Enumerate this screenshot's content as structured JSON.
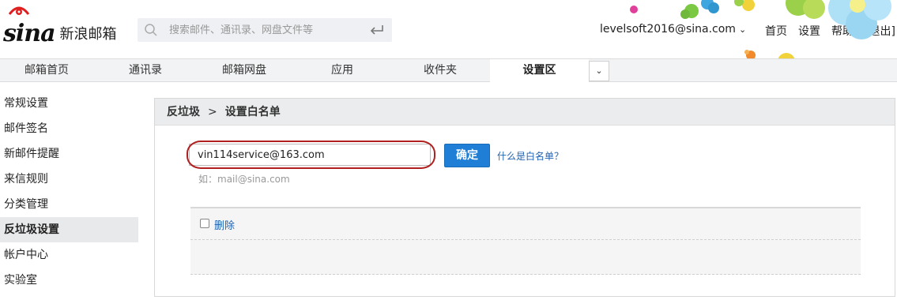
{
  "header": {
    "logo_main": "sina",
    "logo_text": "新浪邮箱",
    "search_placeholder": "搜索邮件、通讯录、网盘文件等",
    "account": "levelsoft2016@sina.com",
    "top_links": [
      "首页",
      "设置",
      "帮助",
      "[退出]"
    ]
  },
  "nav": {
    "tabs": [
      "邮箱首页",
      "通讯录",
      "邮箱网盘",
      "应用",
      "收件夹",
      "设置区"
    ],
    "active_tab": "设置区"
  },
  "sidebar": {
    "items": [
      "常规设置",
      "邮件签名",
      "新邮件提醒",
      "来信规则",
      "分类管理",
      "反垃圾设置",
      "帐户中心",
      "实验室"
    ],
    "active_item": "反垃圾设置"
  },
  "main": {
    "breadcrumb_parent": "反垃圾",
    "breadcrumb_sep": ">",
    "breadcrumb_current": "设置白名单",
    "email_value": "vin114service@163.com",
    "confirm_label": "确定",
    "help_link": "什么是白名单？",
    "hint": "如：mail@sina.com",
    "delete_label": "删除"
  },
  "colors": {
    "accent_blue": "#1f7fd6",
    "link_blue": "#1f62b0",
    "highlight_red": "#b02020",
    "nav_bg": "#f2f3f4"
  }
}
